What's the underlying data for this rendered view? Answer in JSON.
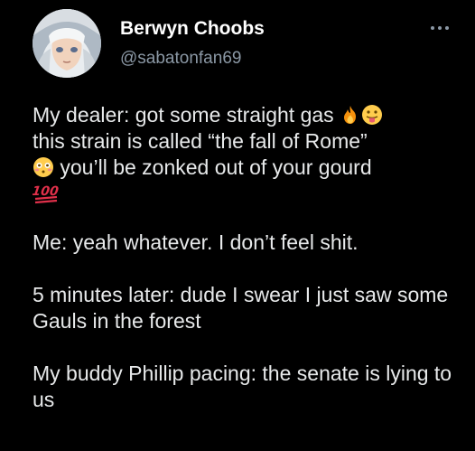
{
  "post": {
    "author": {
      "display_name": "Berwyn Choobs",
      "handle": "@sabatonfan69",
      "avatar_icon": "anime-avatar"
    },
    "more_icon": "more-dots-icon",
    "lines": {
      "dealer_1": "My dealer: got some straight gas",
      "dealer_2": "this strain is called “the fall of Rome”",
      "dealer_3": " you’ll be zonked out of your gourd",
      "me": "Me: yeah whatever. I don’t feel shit.",
      "later": "5 minutes later: dude I swear I just saw some Gauls in the forest",
      "buddy": "My buddy Phillip pacing: the senate is lying to us"
    },
    "emojis": {
      "fire": "fire-emoji",
      "tongue": "face-with-tongue-emoji",
      "flushed": "flushed-face-emoji",
      "hundred": "hundred-points-emoji"
    },
    "colors": {
      "background": "#000000",
      "text": "#e7e9ea",
      "secondary": "#8b98a5"
    }
  }
}
